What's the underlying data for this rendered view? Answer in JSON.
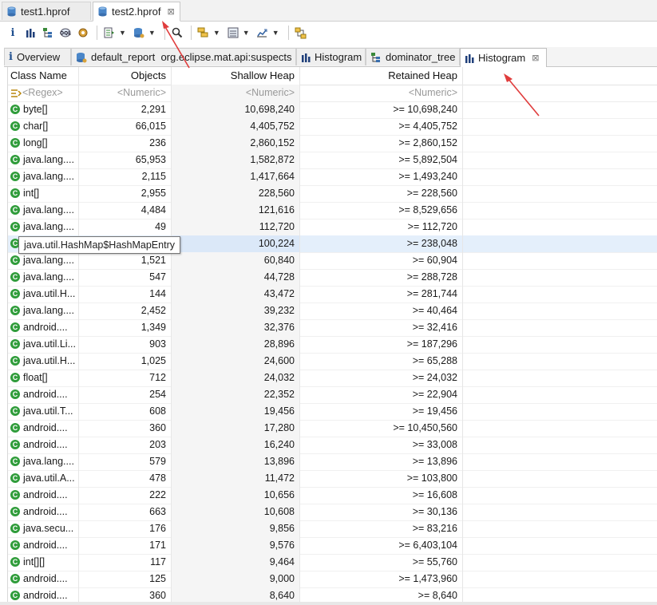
{
  "editor_tabs": [
    {
      "label": "test1.hprof",
      "active": false
    },
    {
      "label": "test2.hprof",
      "active": true,
      "close": "⊠"
    }
  ],
  "view_tabs": [
    {
      "label": "Overview",
      "icon": "info-icon"
    },
    {
      "label": "default_report  org.eclipse.mat.api:suspects",
      "icon": "report-icon"
    },
    {
      "label": "Histogram",
      "icon": "histogram-icon"
    },
    {
      "label": "dominator_tree",
      "icon": "tree-icon"
    },
    {
      "label": "Histogram",
      "icon": "histogram-icon",
      "close": "⊠",
      "active": true
    }
  ],
  "table": {
    "headers": [
      "Class Name",
      "Objects",
      "Shallow Heap",
      "Retained Heap"
    ],
    "filters": [
      "<Regex>",
      "<Numeric>",
      "<Numeric>",
      "<Numeric>"
    ],
    "rows": [
      [
        "byte[]",
        "2,291",
        "10,698,240",
        ">= 10,698,240"
      ],
      [
        "char[]",
        "66,015",
        "4,405,752",
        ">= 4,405,752"
      ],
      [
        "long[]",
        "236",
        "2,860,152",
        ">= 2,860,152"
      ],
      [
        "java.lang....",
        "65,953",
        "1,582,872",
        ">= 5,892,504"
      ],
      [
        "java.lang....",
        "2,115",
        "1,417,664",
        ">= 1,493,240"
      ],
      [
        "int[]",
        "2,955",
        "228,560",
        ">= 228,560"
      ],
      [
        "java.lang....",
        "4,484",
        "121,616",
        ">= 8,529,656"
      ],
      [
        "java.lang....",
        "49",
        "112,720",
        ">= 112,720"
      ],
      [
        "",
        "",
        "100,224",
        ">= 238,048"
      ],
      [
        "java.lang....",
        "1,521",
        "60,840",
        ">= 60,904"
      ],
      [
        "java.lang....",
        "547",
        "44,728",
        ">= 288,728"
      ],
      [
        "java.util.H...",
        "144",
        "43,472",
        ">= 281,744"
      ],
      [
        "java.lang....",
        "2,452",
        "39,232",
        ">= 40,464"
      ],
      [
        "android....",
        "1,349",
        "32,376",
        ">= 32,416"
      ],
      [
        "java.util.Li...",
        "903",
        "28,896",
        ">= 187,296"
      ],
      [
        "java.util.H...",
        "1,025",
        "24,600",
        ">= 65,288"
      ],
      [
        "float[]",
        "712",
        "24,032",
        ">= 24,032"
      ],
      [
        "android....",
        "254",
        "22,352",
        ">= 22,904"
      ],
      [
        "java.util.T...",
        "608",
        "19,456",
        ">= 19,456"
      ],
      [
        "android....",
        "360",
        "17,280",
        ">= 10,450,560"
      ],
      [
        "android....",
        "203",
        "16,240",
        ">= 33,008"
      ],
      [
        "java.lang....",
        "579",
        "13,896",
        ">= 13,896"
      ],
      [
        "java.util.A...",
        "478",
        "11,472",
        ">= 103,800"
      ],
      [
        "android....",
        "222",
        "10,656",
        ">= 16,608"
      ],
      [
        "android....",
        "663",
        "10,608",
        ">= 30,136"
      ],
      [
        "java.secu...",
        "176",
        "9,856",
        ">= 83,216"
      ],
      [
        "android....",
        "171",
        "9,576",
        ">= 6,403,104"
      ],
      [
        "int[][]",
        "117",
        "9,464",
        ">= 55,760"
      ],
      [
        "android....",
        "125",
        "9,000",
        ">= 1,473,960"
      ],
      [
        "android....",
        "360",
        "8,640",
        ">= 8,640"
      ]
    ],
    "selected_row": 8,
    "tooltip": "java.util.HashMap$HashMapEntry"
  },
  "colors": {
    "class_icon": "#2f9c3a",
    "selection": "#e4effb",
    "annotation_arrow": "#e03c3c"
  }
}
